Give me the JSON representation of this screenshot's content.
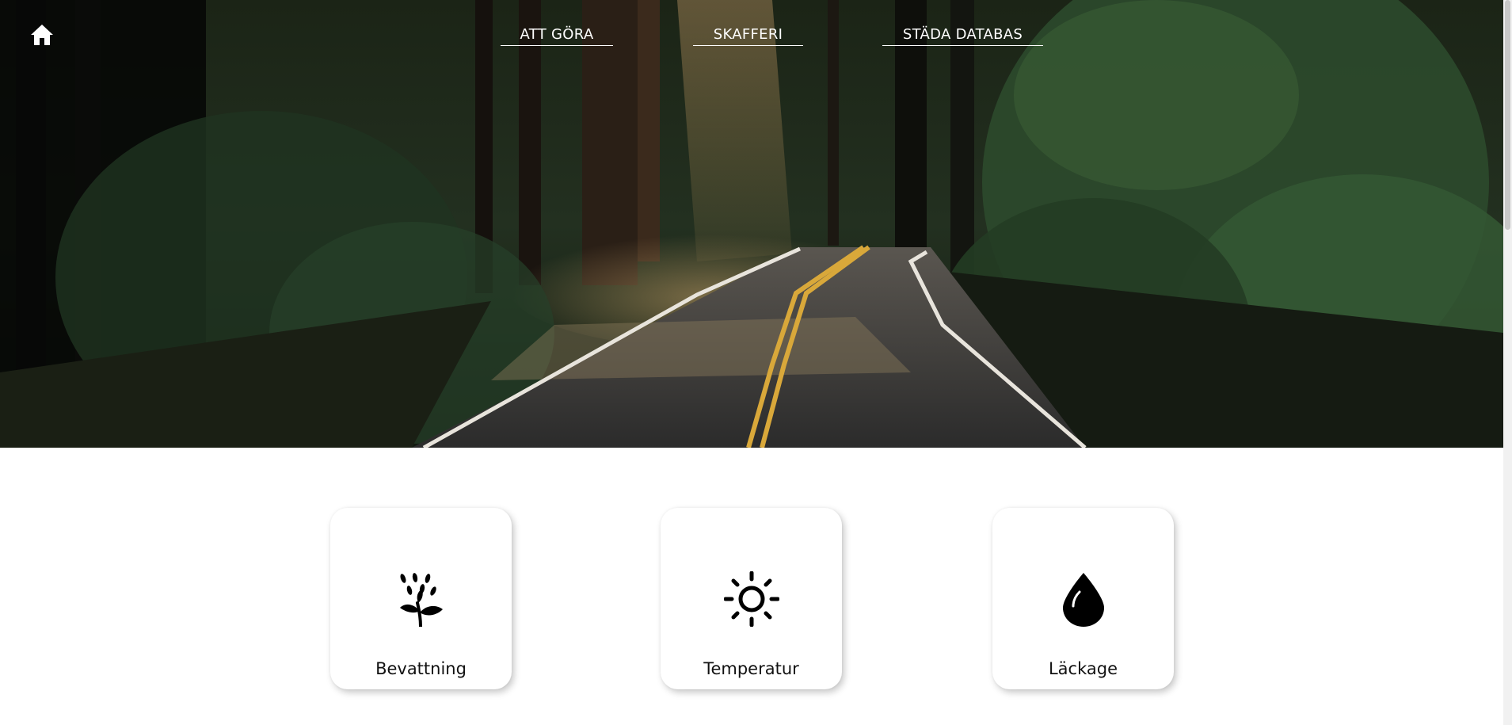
{
  "nav": {
    "home_icon": "home-icon",
    "items": [
      {
        "label": "ATT GÖRA"
      },
      {
        "label": "SKAFFERI"
      },
      {
        "label": "STÄDA DATABAS"
      }
    ]
  },
  "cards": [
    {
      "label": "Bevattning",
      "icon": "sprout-icon"
    },
    {
      "label": "Temperatur",
      "icon": "sun-icon"
    },
    {
      "label": "Läckage",
      "icon": "water-drop-icon"
    }
  ],
  "colors": {
    "nav_text": "#ffffff",
    "card_background": "#ffffff",
    "card_text": "#111111",
    "icon": "#000000"
  }
}
